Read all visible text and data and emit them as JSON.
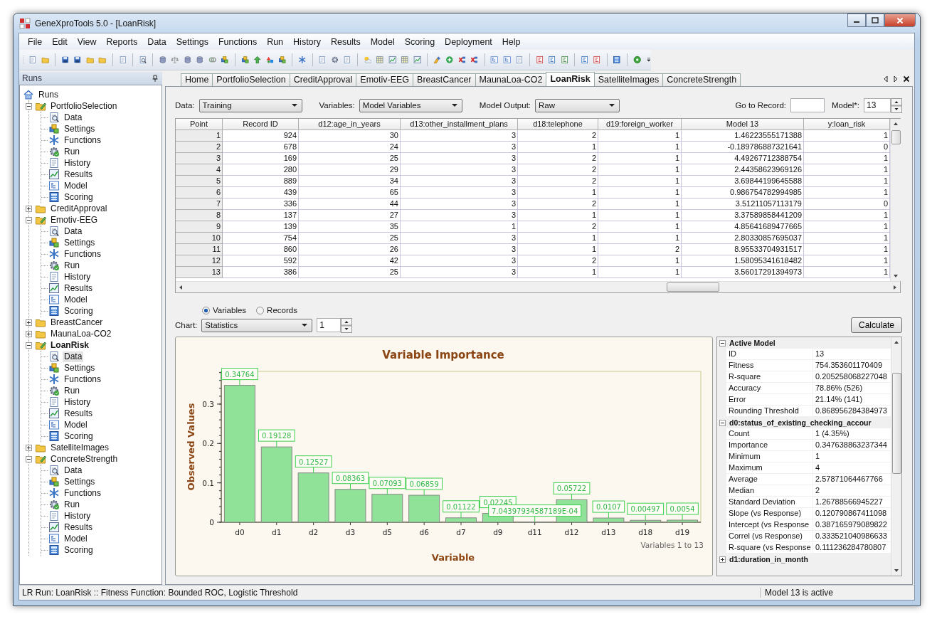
{
  "window": {
    "title": "GeneXproTools 5.0 - [LoanRisk]"
  },
  "menu": [
    "File",
    "Edit",
    "View",
    "Reports",
    "Data",
    "Settings",
    "Functions",
    "Run",
    "History",
    "Results",
    "Model",
    "Scoring",
    "Deployment",
    "Help"
  ],
  "sidebar": {
    "title": "Runs",
    "tree": [
      {
        "label": "Runs",
        "selected": false,
        "children": [
          {
            "label": "PortfolioSelection",
            "expanded": true,
            "active": false,
            "selected": false,
            "children": [
              {
                "label": "Data",
                "selected": false
              },
              {
                "label": "Settings",
                "selected": false
              },
              {
                "label": "Functions",
                "selected": false
              },
              {
                "label": "Run",
                "selected": false
              },
              {
                "label": "History",
                "selected": false
              },
              {
                "label": "Results",
                "selected": false
              },
              {
                "label": "Model",
                "selected": false
              },
              {
                "label": "Scoring",
                "selected": false
              }
            ]
          },
          {
            "label": "CreditApproval",
            "expanded": false,
            "active": false,
            "selected": false
          },
          {
            "label": "Emotiv-EEG",
            "expanded": true,
            "active": false,
            "selected": false,
            "children": [
              {
                "label": "Data",
                "selected": false
              },
              {
                "label": "Settings",
                "selected": false
              },
              {
                "label": "Functions",
                "selected": false
              },
              {
                "label": "Run",
                "selected": false
              },
              {
                "label": "History",
                "selected": false
              },
              {
                "label": "Results",
                "selected": false
              },
              {
                "label": "Model",
                "selected": false
              },
              {
                "label": "Scoring",
                "selected": false
              }
            ]
          },
          {
            "label": "BreastCancer",
            "expanded": false,
            "active": false,
            "selected": false
          },
          {
            "label": "MaunaLoa-CO2",
            "expanded": false,
            "active": false,
            "selected": false
          },
          {
            "label": "LoanRisk",
            "expanded": true,
            "active": true,
            "selected": false,
            "children": [
              {
                "label": "Data",
                "selected": true
              },
              {
                "label": "Settings",
                "selected": false
              },
              {
                "label": "Functions",
                "selected": false
              },
              {
                "label": "Run",
                "selected": false
              },
              {
                "label": "History",
                "selected": false
              },
              {
                "label": "Results",
                "selected": false
              },
              {
                "label": "Model",
                "selected": false
              },
              {
                "label": "Scoring",
                "selected": false
              }
            ]
          },
          {
            "label": "SatelliteImages",
            "expanded": false,
            "active": false,
            "selected": false
          },
          {
            "label": "ConcreteStrength",
            "expanded": true,
            "active": false,
            "selected": false,
            "children": [
              {
                "label": "Data",
                "selected": false
              },
              {
                "label": "Settings",
                "selected": false
              },
              {
                "label": "Functions",
                "selected": false
              },
              {
                "label": "Run",
                "selected": false
              },
              {
                "label": "History",
                "selected": false
              },
              {
                "label": "Results",
                "selected": false
              },
              {
                "label": "Model",
                "selected": false
              },
              {
                "label": "Scoring",
                "selected": false
              }
            ]
          }
        ]
      }
    ]
  },
  "tabs": [
    {
      "label": "Home",
      "selected": false
    },
    {
      "label": "PortfolioSelection",
      "selected": false
    },
    {
      "label": "CreditApproval",
      "selected": false
    },
    {
      "label": "Emotiv-EEG",
      "selected": false
    },
    {
      "label": "BreastCancer",
      "selected": false
    },
    {
      "label": "MaunaLoa-CO2",
      "selected": false
    },
    {
      "label": "LoanRisk",
      "selected": true
    },
    {
      "label": "SatelliteImages",
      "selected": false
    },
    {
      "label": "ConcreteStrength",
      "selected": false
    }
  ],
  "controls": {
    "data": {
      "label": "Data:",
      "value": "Training"
    },
    "variables": {
      "label": "Variables:",
      "value": "Model Variables"
    },
    "model_output": {
      "label": "Model Output:",
      "value": "Raw"
    },
    "go_to_record": {
      "label": "Go to Record:"
    },
    "model": {
      "label": "Model*:",
      "value": "13"
    }
  },
  "table": {
    "columns": [
      "Point",
      "Record ID",
      "d12:age_in_years",
      "d13:other_installment_plans",
      "d18:telephone",
      "d19:foreign_worker",
      "Model 13",
      "y:loan_risk"
    ],
    "rows": [
      [
        "1",
        "924",
        "30",
        "3",
        "2",
        "1",
        "1.46223555171388",
        "1"
      ],
      [
        "2",
        "678",
        "24",
        "3",
        "1",
        "1",
        "-0.189786887321641",
        "0"
      ],
      [
        "3",
        "169",
        "25",
        "3",
        "2",
        "1",
        "4.49267712388754",
        "1"
      ],
      [
        "4",
        "280",
        "29",
        "3",
        "2",
        "1",
        "2.44358623969126",
        "1"
      ],
      [
        "5",
        "889",
        "34",
        "3",
        "2",
        "1",
        "3.69844199645588",
        "1"
      ],
      [
        "6",
        "439",
        "65",
        "3",
        "1",
        "1",
        "0.986754782994985",
        "1"
      ],
      [
        "7",
        "336",
        "44",
        "3",
        "2",
        "1",
        "3.51211057113179",
        "0"
      ],
      [
        "8",
        "137",
        "27",
        "3",
        "1",
        "1",
        "3.37589858441209",
        "1"
      ],
      [
        "9",
        "139",
        "35",
        "1",
        "2",
        "1",
        "4.85641689477665",
        "1"
      ],
      [
        "10",
        "754",
        "25",
        "3",
        "1",
        "1",
        "2.80330857695037",
        "1"
      ],
      [
        "11",
        "860",
        "26",
        "3",
        "1",
        "2",
        "8.95533704931517",
        "1"
      ],
      [
        "12",
        "592",
        "42",
        "3",
        "2",
        "1",
        "1.58095341618482",
        "1"
      ],
      [
        "13",
        "386",
        "25",
        "3",
        "1",
        "1",
        "3.56017291394973",
        "1"
      ]
    ]
  },
  "chart_mode": [
    {
      "label": "Variables",
      "selected": true
    },
    {
      "label": "Records",
      "selected": false
    }
  ],
  "chart_select": {
    "label": "Chart:",
    "value": "Statistics",
    "number": "1"
  },
  "calculate_button": "Calculate",
  "chart": {
    "note": "Variables 1 to 13",
    "chart_data": {
      "type": "bar",
      "title": "Variable Importance",
      "xlabel": "Variable",
      "ylabel": "Observed Values",
      "categories": [
        "d0",
        "d1",
        "d2",
        "d3",
        "d5",
        "d6",
        "d7",
        "d9",
        "d11",
        "d12",
        "d13",
        "d18",
        "d19"
      ],
      "values": [
        0.34764,
        0.19128,
        0.12527,
        0.08363,
        0.07093,
        0.06859,
        0.01122,
        0.02245,
        0.000704397934587189,
        0.05722,
        0.0107,
        0.00497,
        0.0054
      ],
      "value_labels": [
        "0.34764",
        "0.19128",
        "0.12527",
        "0.08363",
        "0.07093",
        "0.06859",
        "0.01122",
        "0.02245",
        "7.04397934587189E-04",
        "0.05722",
        "0.0107",
        "0.00497",
        "0.0054"
      ],
      "ylim": [
        0,
        0.383
      ],
      "yticks": [
        0,
        0.1,
        0.2,
        0.3
      ]
    }
  },
  "properties": {
    "sections": [
      {
        "title": "Active Model",
        "expanded": true,
        "rows": [
          {
            "name": "ID",
            "value": "13"
          },
          {
            "name": "Fitness",
            "value": "754.353601170409"
          },
          {
            "name": "R-square",
            "value": "0.205258068227048"
          },
          {
            "name": "Accuracy",
            "value": "78.86% (526)"
          },
          {
            "name": "Error",
            "value": "21.14% (141)"
          },
          {
            "name": "Rounding Threshold",
            "value": "0.868956284384973"
          }
        ]
      },
      {
        "title": "d0:status_of_existing_checking_accour",
        "expanded": true,
        "rows": [
          {
            "name": "Count",
            "value": "1 (4.35%)"
          },
          {
            "name": "Importance",
            "value": "0.347638863237344"
          },
          {
            "name": "Minimum",
            "value": "1"
          },
          {
            "name": "Maximum",
            "value": "4"
          },
          {
            "name": "Average",
            "value": "2.57871064467766"
          },
          {
            "name": "Median",
            "value": "2"
          },
          {
            "name": "Standard Deviation",
            "value": "1.26788566945227"
          },
          {
            "name": "Slope (vs Response)",
            "value": "0.120790867411098"
          },
          {
            "name": "Intercept (vs Response",
            "value": "0.387165979089822"
          },
          {
            "name": "Correl (vs Response)",
            "value": "0.333521040986633"
          },
          {
            "name": "R-square (vs Response",
            "value": "0.111236284780807"
          }
        ]
      },
      {
        "title": "d1:duration_in_month",
        "expanded": false
      }
    ]
  },
  "status_bar": [
    "LR Run: LoanRisk :: Fitness Function: Bounded ROC, Logistic Threshold",
    "Model 13 is active"
  ]
}
